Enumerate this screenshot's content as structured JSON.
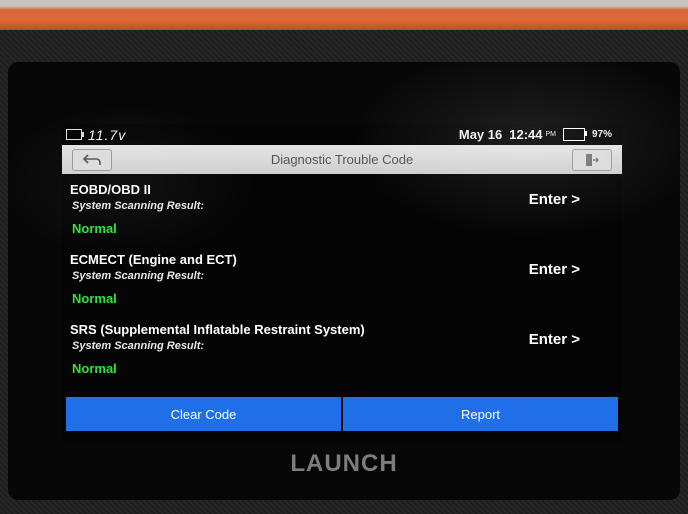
{
  "status": {
    "voltage": "11.7v",
    "date": "May 16",
    "time": "12:44",
    "ampm": "PM",
    "battery_pct": "97%"
  },
  "nav": {
    "title": "Diagnostic Trouble Code",
    "back_icon": "back-arrow-icon",
    "exit_icon": "exit-door-icon"
  },
  "systems": [
    {
      "name": "EOBD/OBD II",
      "subtitle": "System Scanning Result:",
      "status": "Normal",
      "action": "Enter >"
    },
    {
      "name": "ECMECT (Engine and ECT)",
      "subtitle": "System Scanning Result:",
      "status": "Normal",
      "action": "Enter >"
    },
    {
      "name": "SRS (Supplemental Inflatable Restraint System)",
      "subtitle": "System Scanning Result:",
      "status": "Normal",
      "action": "Enter >"
    }
  ],
  "actions": {
    "clear_code": "Clear Code",
    "report": "Report"
  },
  "device": {
    "brand": "LAUNCH"
  },
  "colors": {
    "status_normal": "#2fe33c",
    "button_blue": "#1f6fe8",
    "battery_green": "#3fe04a"
  }
}
